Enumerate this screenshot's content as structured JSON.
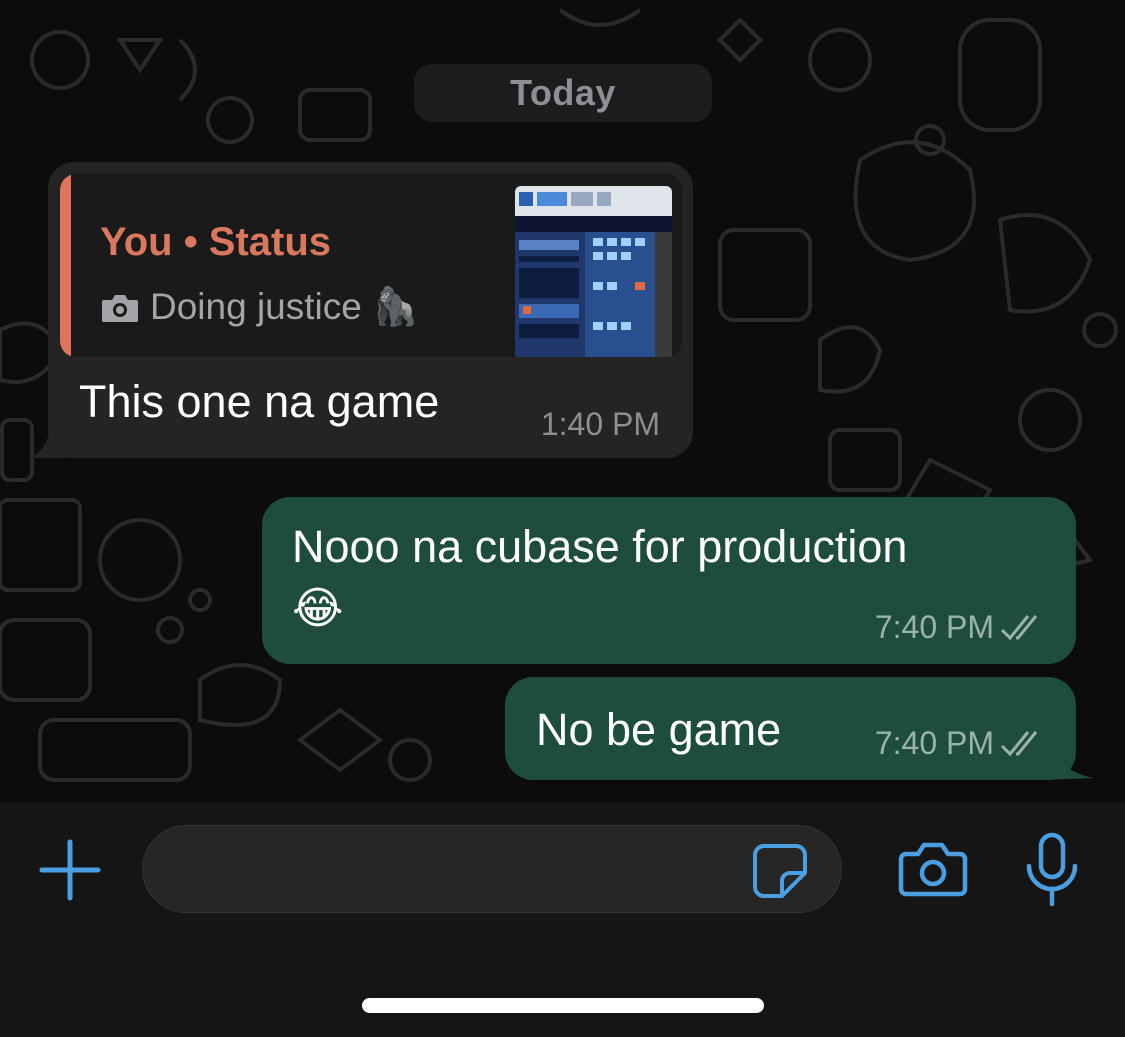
{
  "date_separator": "Today",
  "messages": [
    {
      "direction": "incoming",
      "quote": {
        "author": "You • Status",
        "caption": "Doing justice 🦍",
        "media_icon": "camera-icon",
        "thumbnail_icon": "cubase-screenshot-thumbnail"
      },
      "text": "This one na game",
      "time": "1:40 PM"
    },
    {
      "direction": "outgoing",
      "text_line1": "Nooo na cubase for production",
      "text_line2": "😂",
      "time": "7:40 PM",
      "status_icon": "double-check-icon"
    },
    {
      "direction": "outgoing",
      "text": "No be game",
      "time": "7:40 PM",
      "status_icon": "double-check-icon"
    }
  ],
  "composer": {
    "attach_icon": "plus-icon",
    "sticker_icon": "sticker-icon",
    "camera_icon": "camera-icon",
    "mic_icon": "microphone-icon"
  },
  "colors": {
    "accent": "#4b9fe1",
    "outgoing_bubble": "#1e4d3e",
    "incoming_bubble": "#242424",
    "quote_accent": "#e0755c"
  }
}
